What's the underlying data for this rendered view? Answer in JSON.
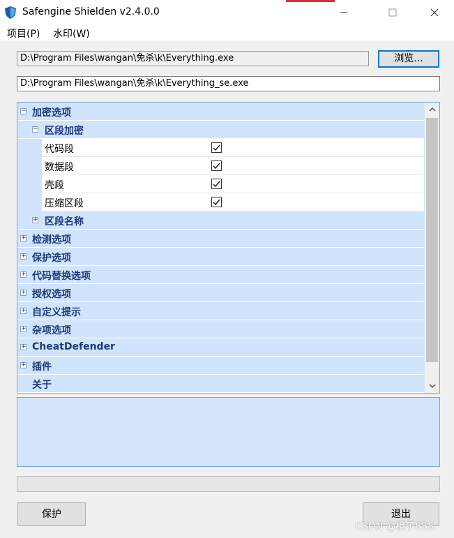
{
  "window": {
    "title": "Safengine Shielden v2.4.0.0"
  },
  "menu": {
    "items": [
      "项目(P)",
      "水印(W)"
    ]
  },
  "source_path": "D:\\Program Files\\wangan\\免杀\\k\\Everything.exe",
  "output_path": "D:\\Program Files\\wangan\\免杀\\k\\Everything_se.exe",
  "browse_label": "浏览...",
  "tree": {
    "encrypt_options": "加密选项",
    "section_encrypt": "区段加密",
    "leaves": [
      {
        "label": "代码段",
        "checked": true
      },
      {
        "label": "数据段",
        "checked": true
      },
      {
        "label": "壳段",
        "checked": true
      },
      {
        "label": "压缩区段",
        "checked": true
      }
    ],
    "section_names": "区段名称",
    "groups": [
      "检测选项",
      "保护选项",
      "代码替换选项",
      "授权选项",
      "自定义提示",
      "杂项选项",
      "CheatDefender",
      "插件"
    ],
    "about": "关于"
  },
  "buttons": {
    "protect": "保护",
    "exit": "退出"
  },
  "watermark": "CSDN @橙子555."
}
